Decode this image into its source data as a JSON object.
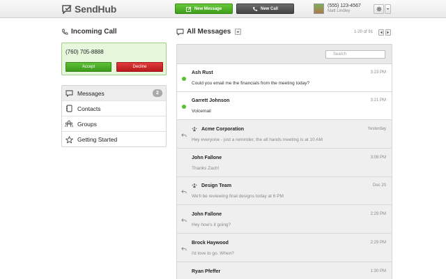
{
  "app": {
    "name": "SendHub"
  },
  "topbar": {
    "new_message_label": "New Message",
    "new_call_label": "New Call",
    "user_phone": "(555) 123-4567",
    "user_name": "Matt Lindley"
  },
  "incoming_call": {
    "title": "Incoming Call",
    "number": "(760) 705-8888",
    "accept_label": "Accept",
    "decline_label": "Decline"
  },
  "nav": {
    "items": [
      {
        "label": "Messages",
        "badge": "2",
        "icon": "speech-bubble-icon",
        "active": true
      },
      {
        "label": "Contacts",
        "icon": "address-book-icon"
      },
      {
        "label": "Groups",
        "icon": "people-icon"
      },
      {
        "label": "Getting Started",
        "icon": "star-icon"
      }
    ]
  },
  "messages_panel": {
    "title": "All Messages",
    "pager": "1-20 of 91",
    "search_placeholder": "Search",
    "rows": [
      {
        "name": "Ash Rust",
        "preview": "Could you email me the financials from the meeting today?",
        "time": "3:23 PM",
        "status": "unread"
      },
      {
        "name": "Garrett Johnson",
        "preview": "Voicemail",
        "time": "3:21 PM",
        "status": "unread"
      },
      {
        "name": "Acme Corporation",
        "preview": "Hey everyone - just a reminder, the all hands meeting is at 10 AM",
        "time": "Yesterday",
        "status": "replied",
        "group": true
      },
      {
        "name": "John Fallone",
        "preview": "Thanks Zach!",
        "time": "3:08 PM",
        "status": "read"
      },
      {
        "name": "Design Team",
        "preview": "We'll be reviewing final designs today at 6 PM",
        "time": "Dec 20",
        "status": "replied",
        "group": true
      },
      {
        "name": "John Fallone",
        "preview": "Hey how's it going?",
        "time": "2:29 PM",
        "status": "replied"
      },
      {
        "name": "Brock Haywood",
        "preview": "I'd love to go. When?",
        "time": "2:29 PM",
        "status": "replied"
      },
      {
        "name": "Ryan Pfeffer",
        "preview": "",
        "time": "1:30 PM",
        "status": "read"
      }
    ]
  },
  "colors": {
    "accent_green": "#4caf26",
    "decline_red": "#c8282a",
    "unread_dot": "#5bbf2c"
  }
}
